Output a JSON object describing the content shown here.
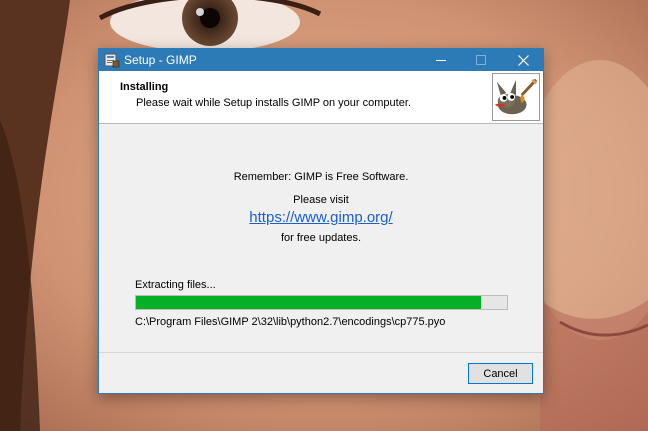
{
  "window": {
    "title": "Setup - GIMP",
    "accent_color": "#2c7bb6"
  },
  "header": {
    "title": "Installing",
    "subtitle": "Please wait while Setup installs GIMP on your computer.",
    "logo_icon": "gimp-wilber-logo"
  },
  "body": {
    "line1": "Remember: GIMP is Free Software.",
    "line2": "Please visit",
    "link": "https://www.gimp.org/",
    "line3": "for free updates."
  },
  "progress": {
    "label": "Extracting files...",
    "percent": 93,
    "fill_color": "#06b025",
    "file": "C:\\Program Files\\GIMP 2\\32\\lib\\python2.7\\encodings\\cp775.pyo"
  },
  "buttons": {
    "cancel": "Cancel"
  }
}
